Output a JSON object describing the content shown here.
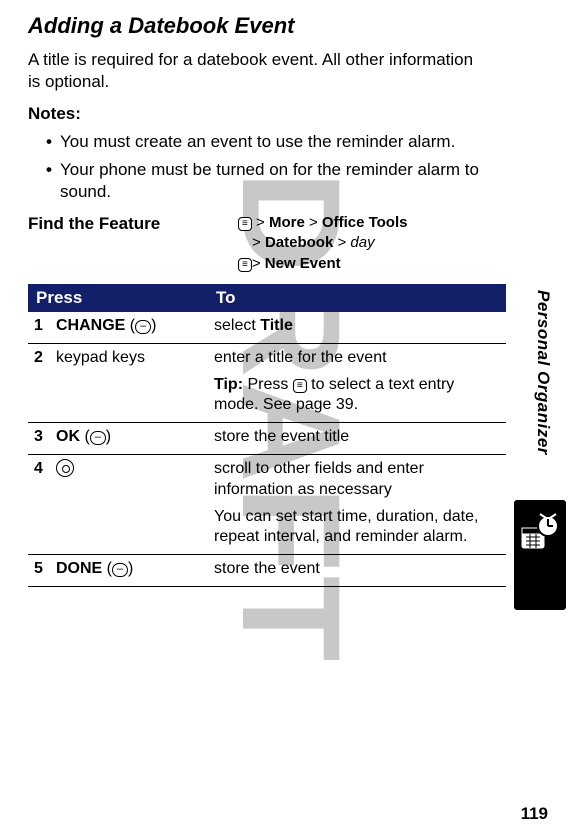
{
  "watermark": "DRAFT",
  "side_label": "Personal Organizer",
  "page_number": "119",
  "section": {
    "title": "Adding a Datebook Event",
    "intro": "A title is required for a datebook event. All other information is optional.",
    "notes_label": "Notes:",
    "notes": [
      "You must create an event to use the reminder alarm.",
      "Your phone must be turned on for the reminder alarm to sound."
    ]
  },
  "find": {
    "label": "Find the Feature",
    "menu_key_glyph": "≡",
    "gt": ">",
    "line1": {
      "more": "More",
      "office_tools": "Office Tools"
    },
    "line2": {
      "datebook": "Datebook",
      "day": "day"
    },
    "line3": {
      "new_event": "New Event"
    }
  },
  "table": {
    "headers": {
      "press": "Press",
      "to": "To"
    },
    "rows": [
      {
        "num": "1",
        "press_label": "CHANGE",
        "press_btn": "–",
        "to_html": "select <b class='bold-menu'>Title</b>"
      },
      {
        "num": "2",
        "press_plain": "keypad keys",
        "to_lines": [
          "enter a title for the event",
          "<b>Tip:</b> Press <span class='menu-key'>≡</span> to select a text entry mode. See page 39."
        ]
      },
      {
        "num": "3",
        "press_label": "OK",
        "press_btn": "–",
        "to_html": "store the event title"
      },
      {
        "num": "4",
        "press_nav": true,
        "to_lines": [
          "scroll to other fields and enter information as necessary",
          "You can set start time, duration, date, repeat interval, and reminder alarm."
        ]
      },
      {
        "num": "5",
        "press_label": "DONE",
        "press_btn": "–",
        "to_html": "store the event"
      }
    ]
  }
}
